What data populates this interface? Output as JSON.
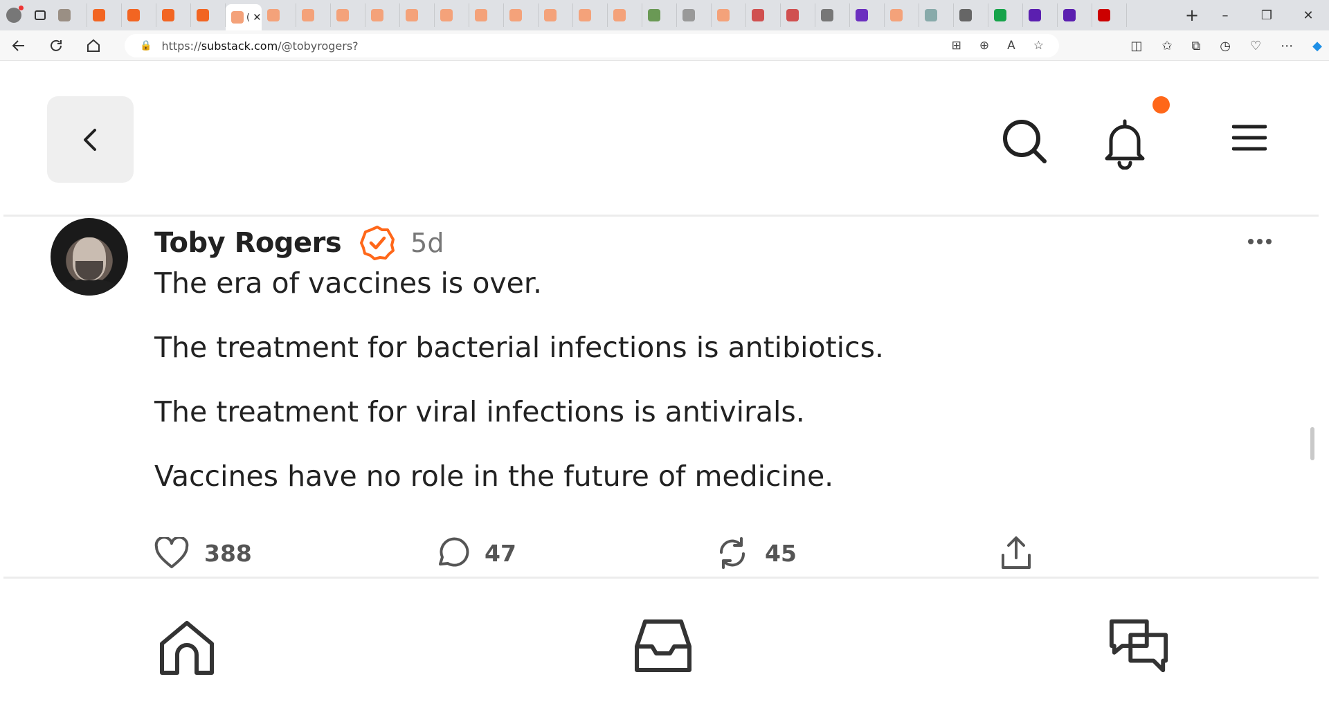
{
  "browser": {
    "active_tab_label": "(",
    "tab_count": 31,
    "url_prefix": "https://",
    "url_domain": "substack.com",
    "url_path": "/@tobyrogers?",
    "window_controls": [
      "–",
      "❐",
      "✕"
    ]
  },
  "header": {
    "notification_dot_color": "#ff6719"
  },
  "post": {
    "author": "Toby Rogers",
    "age": "5d",
    "verified_color": "#ff6719",
    "paragraphs": [
      "The era of vaccines is over.",
      "The treatment for bacterial infections is antibiotics.",
      "The treatment for viral infections is antivirals.",
      "Vaccines have no role in the future of medicine."
    ],
    "likes": "388",
    "comments": "47",
    "restacks": "45"
  },
  "bottom_nav": {
    "items": [
      "home-icon",
      "inbox-icon",
      "chat-icon"
    ]
  }
}
